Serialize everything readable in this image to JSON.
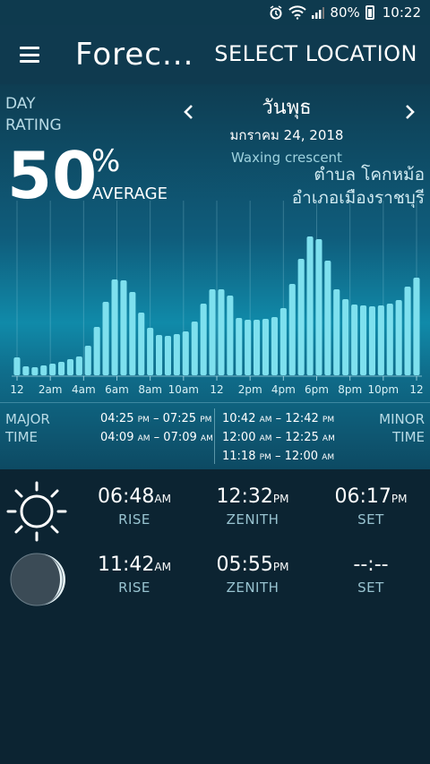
{
  "status_bar": {
    "battery": "80%",
    "time": "10:22"
  },
  "app_bar": {
    "title": "Forec...",
    "select_location": "SELECT LOCATION"
  },
  "day_rating": {
    "label_line1": "DAY",
    "label_line2": "RATING",
    "value": "50",
    "percent_sign": "%",
    "rating_text": "AVERAGE"
  },
  "date": {
    "day_name": "วันพุธ",
    "full_date": "มกราคม 24, 2018",
    "moon_phase": "Waxing crescent"
  },
  "location": {
    "line1": "ตำบล โคกหม้อ",
    "line2": "อำเภอเมืองราชบุรี"
  },
  "chart_data": {
    "type": "bar",
    "x_tick_labels": [
      "12",
      "2am",
      "4am",
      "6am",
      "8am",
      "10am",
      "12",
      "2pm",
      "4pm",
      "6pm",
      "8pm",
      "10pm",
      "12"
    ],
    "values": [
      20,
      10,
      9,
      11,
      13,
      15,
      18,
      21,
      33,
      54,
      82,
      107,
      106,
      93,
      70,
      53,
      45,
      44,
      46,
      49,
      60,
      80,
      96,
      96,
      89,
      64,
      62,
      62,
      63,
      65,
      75,
      102,
      130,
      155,
      152,
      128,
      96,
      85,
      79,
      78,
      77,
      78,
      80,
      84,
      99,
      109
    ],
    "ylim": [
      0,
      170
    ],
    "bar_color": "#7ee0ee"
  },
  "times": {
    "major_label_line1": "MAJOR",
    "major_label_line2": "TIME",
    "minor_label_line1": "MINOR",
    "minor_label_line2": "TIME",
    "major": [
      {
        "start": "04:25",
        "start_ampm": "PM",
        "end": "07:25",
        "end_ampm": "PM"
      },
      {
        "start": "04:09",
        "start_ampm": "AM",
        "end": "07:09",
        "end_ampm": "AM"
      }
    ],
    "minor": [
      {
        "start": "10:42",
        "start_ampm": "AM",
        "end": "12:42",
        "end_ampm": "PM"
      },
      {
        "start": "12:00",
        "start_ampm": "AM",
        "end": "12:25",
        "end_ampm": "AM"
      },
      {
        "start": "11:18",
        "start_ampm": "PM",
        "end": "12:00",
        "end_ampm": "AM"
      }
    ]
  },
  "sun": {
    "icon": "sun-icon",
    "rise": "06:48",
    "rise_ampm": "AM",
    "rise_label": "RISE",
    "zenith": "12:32",
    "zenith_ampm": "PM",
    "zenith_label": "ZENITH",
    "set": "06:17",
    "set_ampm": "PM",
    "set_label": "SET"
  },
  "moon": {
    "icon": "moon-icon",
    "rise": "11:42",
    "rise_ampm": "AM",
    "rise_label": "RISE",
    "zenith": "05:55",
    "zenith_ampm": "PM",
    "zenith_label": "ZENITH",
    "set": "--:--",
    "set_label": "SET"
  },
  "colors": {
    "panel_top": "#0e3d52",
    "panel_mid": "#108aa9",
    "bottom_bg": "#0c2432",
    "bar": "#7ee0ee"
  }
}
